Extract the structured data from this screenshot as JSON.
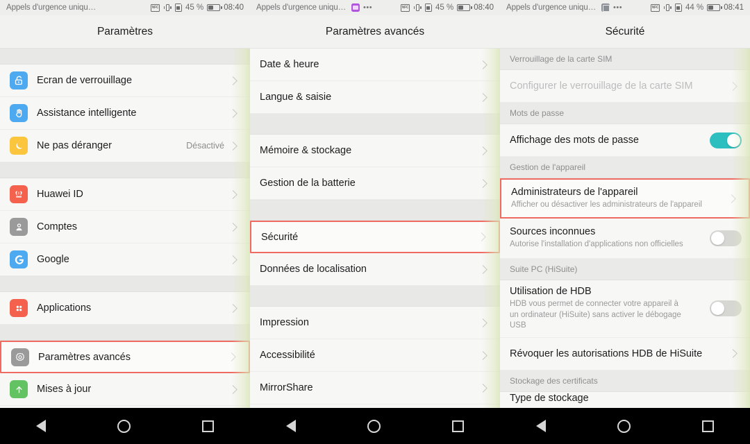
{
  "panels": [
    {
      "id": "settings",
      "status": {
        "carrier": "Appels d'urgence uniqu…",
        "battery_pct": "45 %",
        "battery_level": 45,
        "clock": "08:40",
        "notif_icons": []
      },
      "title": "Paramètres",
      "rows": [
        {
          "type": "gap"
        },
        {
          "type": "row",
          "icon": "lock-icon",
          "icon_color": "#4eaaf0",
          "label": "Ecran de verrouillage",
          "value": "",
          "chevron": true,
          "highlight": false
        },
        {
          "type": "row",
          "icon": "hand-icon",
          "icon_color": "#4eaaf0",
          "label": "Assistance intelligente",
          "value": "",
          "chevron": true,
          "highlight": false
        },
        {
          "type": "row",
          "icon": "moon-icon",
          "icon_color": "#fbc53d",
          "label": "Ne pas déranger",
          "value": "Désactivé",
          "chevron": true,
          "highlight": false
        },
        {
          "type": "gap"
        },
        {
          "type": "row",
          "icon": "huawei-id-icon",
          "icon_color": "#f4624d",
          "label": "Huawei ID",
          "value": "",
          "chevron": true,
          "highlight": false
        },
        {
          "type": "row",
          "icon": "person-icon",
          "icon_color": "#9a9a9a",
          "label": "Comptes",
          "value": "",
          "chevron": true,
          "highlight": false
        },
        {
          "type": "row",
          "icon": "google-icon",
          "icon_color": "#4eaaf0",
          "label": "Google",
          "value": "",
          "chevron": true,
          "highlight": false
        },
        {
          "type": "gap"
        },
        {
          "type": "row",
          "icon": "apps-grid-icon",
          "icon_color": "#f4624d",
          "label": "Applications",
          "value": "",
          "chevron": true,
          "highlight": false
        },
        {
          "type": "gap"
        },
        {
          "type": "row",
          "icon": "gear-icon",
          "icon_color": "#9a9a9a",
          "label": "Paramètres avancés",
          "value": "",
          "chevron": true,
          "highlight": true
        },
        {
          "type": "row",
          "icon": "arrow-up-icon",
          "icon_color": "#63c363",
          "label": "Mises à jour",
          "value": "",
          "chevron": true,
          "highlight": false
        }
      ]
    },
    {
      "id": "advanced",
      "status": {
        "carrier": "Appels d'urgence uniqu…",
        "battery_pct": "45 %",
        "battery_level": 45,
        "clock": "08:40",
        "notif_icons": [
          "notification-purple-icon",
          "overflow-dots-icon"
        ]
      },
      "title": "Paramètres avancés",
      "rows": [
        {
          "type": "row",
          "icon": null,
          "label": "Date & heure",
          "value": "",
          "chevron": true,
          "highlight": false
        },
        {
          "type": "row",
          "icon": null,
          "label": "Langue & saisie",
          "value": "",
          "chevron": true,
          "highlight": false
        },
        {
          "type": "gap"
        },
        {
          "type": "row",
          "icon": null,
          "label": "Mémoire & stockage",
          "value": "",
          "chevron": true,
          "highlight": false
        },
        {
          "type": "row",
          "icon": null,
          "label": "Gestion de la batterie",
          "value": "",
          "chevron": true,
          "highlight": false
        },
        {
          "type": "gap"
        },
        {
          "type": "row",
          "icon": null,
          "label": "Sécurité",
          "value": "",
          "chevron": true,
          "highlight": true
        },
        {
          "type": "row",
          "icon": null,
          "label": "Données de localisation",
          "value": "",
          "chevron": true,
          "highlight": false
        },
        {
          "type": "gap"
        },
        {
          "type": "row",
          "icon": null,
          "label": "Impression",
          "value": "",
          "chevron": true,
          "highlight": false
        },
        {
          "type": "row",
          "icon": null,
          "label": "Accessibilité",
          "value": "",
          "chevron": true,
          "highlight": false
        },
        {
          "type": "row",
          "icon": null,
          "label": "MirrorShare",
          "value": "",
          "chevron": true,
          "highlight": false
        }
      ]
    },
    {
      "id": "security",
      "status": {
        "carrier": "Appels d'urgence uniqu…",
        "battery_pct": "44 %",
        "battery_level": 44,
        "clock": "08:41",
        "notif_icons": [
          "screenshot-icon",
          "overflow-dots-icon"
        ]
      },
      "title": "Sécurité",
      "rows": [
        {
          "type": "section",
          "label": "Verrouillage de la carte SIM"
        },
        {
          "type": "row",
          "icon": null,
          "label": "Configurer le verrouillage de la carte SIM",
          "disabled": true,
          "chevron": true,
          "highlight": false
        },
        {
          "type": "section",
          "label": "Mots de passe"
        },
        {
          "type": "toggle-row",
          "label": "Affichage des mots de passe",
          "sub": "",
          "toggle": "on"
        },
        {
          "type": "section",
          "label": "Gestion de l'appareil"
        },
        {
          "type": "two-line",
          "label": "Administrateurs de l'appareil",
          "sub": "Afficher ou désactiver les administrateurs de l'appareil",
          "chevron": true,
          "highlight": true
        },
        {
          "type": "toggle-two-line",
          "label": "Sources inconnues",
          "sub": "Autorise l'installation d'applications non officielles",
          "toggle": "off"
        },
        {
          "type": "section",
          "label": "Suite PC (HiSuite)"
        },
        {
          "type": "toggle-two-line",
          "label": "Utilisation de HDB",
          "sub": "HDB vous permet de connecter votre appareil à un ordinateur (HiSuite) sans activer le débogage USB",
          "toggle": "off"
        },
        {
          "type": "row",
          "icon": null,
          "label": "Révoquer les autorisations HDB de HiSuite",
          "chevron": true,
          "highlight": false
        },
        {
          "type": "section",
          "label": "Stockage des certificats"
        },
        {
          "type": "cut",
          "label": "Type de stockage"
        }
      ]
    }
  ],
  "navbar": {
    "back": "back-button",
    "home": "home-button",
    "recents": "recents-button"
  },
  "colors": {
    "highlight_border": "#ef6a60",
    "toggle_on": "#2dbfbf",
    "toggle_off": "#d6d6d3",
    "panel_bg": "#f7f7f5",
    "section_bg": "#eaeae8"
  }
}
